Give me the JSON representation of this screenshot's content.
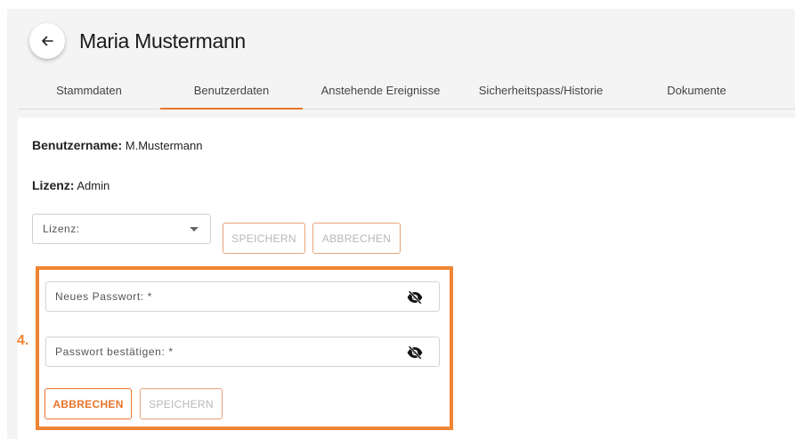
{
  "header": {
    "title": "Maria Mustermann"
  },
  "tabs": [
    {
      "label": "Stammdaten",
      "active": false
    },
    {
      "label": "Benutzerdaten",
      "active": true
    },
    {
      "label": "Anstehende Ereignisse",
      "active": false
    },
    {
      "label": "Sicherheitspass/Historie",
      "active": false
    },
    {
      "label": "Dokumente",
      "active": false
    }
  ],
  "user": {
    "username_label": "Benutzername:",
    "username_value": "M.Mustermann",
    "license_label": "Lizenz:",
    "license_value": "Admin"
  },
  "license_form": {
    "select_placeholder": "Lizenz:",
    "save_label": "SPEICHERN",
    "cancel_label": "ABBRECHEN"
  },
  "password_form": {
    "step_marker": "4.",
    "new_password_placeholder": "Neues Passwort: *",
    "confirm_password_placeholder": "Passwort bestätigen: *",
    "cancel_label": "ABBRECHEN",
    "save_label": "SPEICHERN"
  },
  "icons": {
    "back": "arrow-left-icon",
    "toggle_visibility": "eye-off-icon"
  },
  "colors": {
    "accent": "#e8742d",
    "highlight": "#f08533",
    "panel_bg": "#f4f4f4"
  }
}
